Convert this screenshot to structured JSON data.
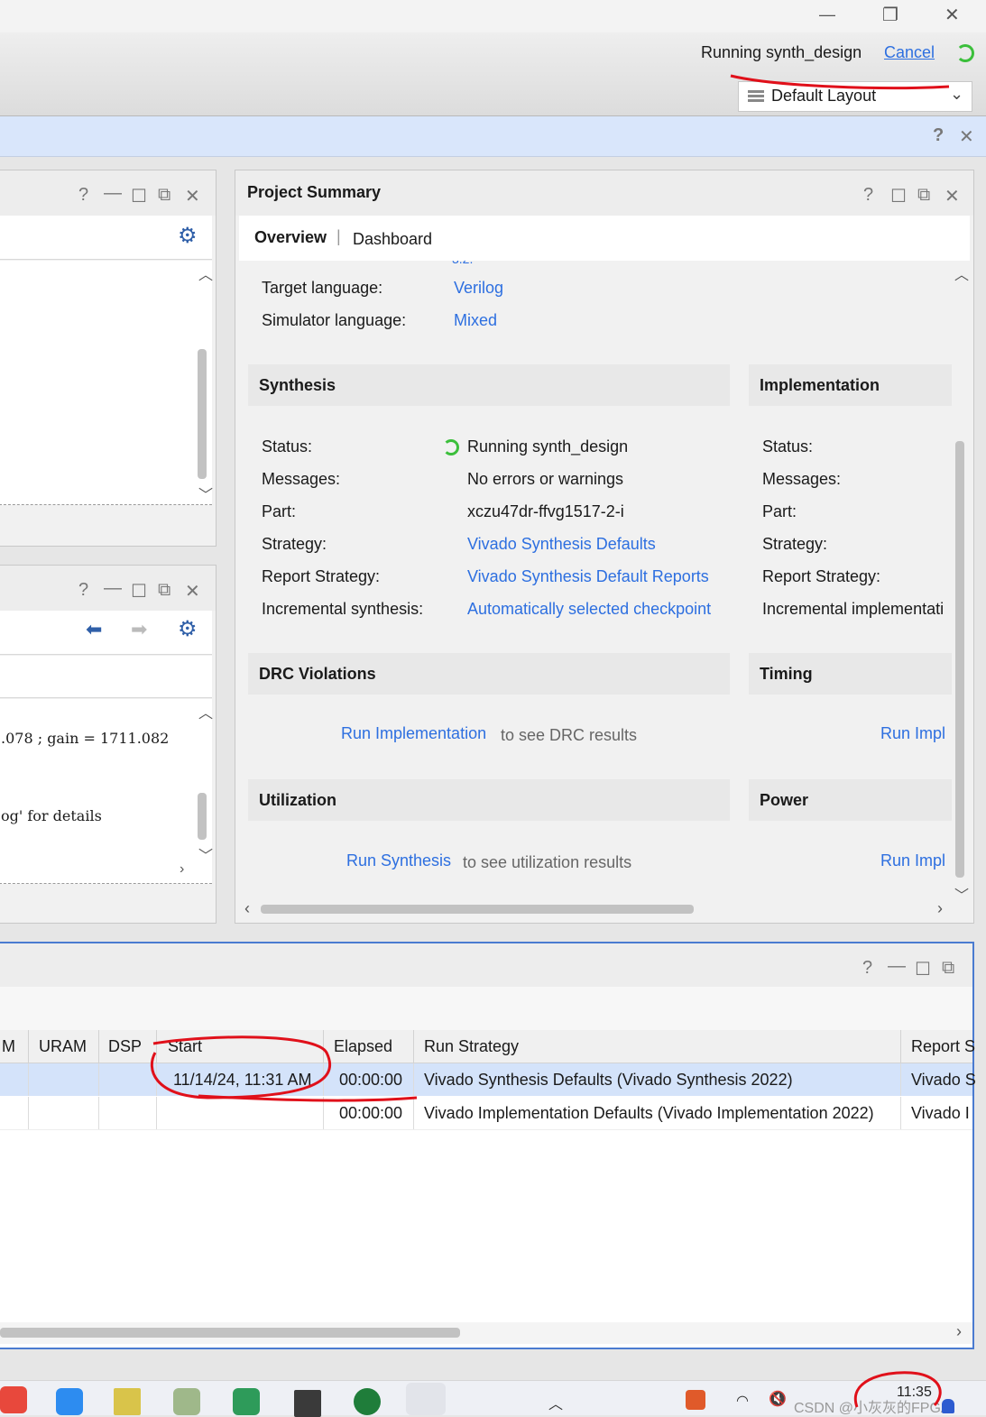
{
  "window": {
    "minimize": "—",
    "restore": "❐",
    "close": "✕"
  },
  "toolbar": {
    "status_text": "Running synth_design",
    "cancel_label": "Cancel",
    "layout_select": "Default Layout"
  },
  "bluebar": {
    "help": "?",
    "close": "✕"
  },
  "left_panels": {
    "top_controls": [
      "?",
      "—",
      "☐",
      "⧉",
      "✕"
    ],
    "mid_controls": [
      "?",
      "—",
      "☐",
      "⧉",
      "✕"
    ],
    "log_line_1": ".078 ; gain = 1711.082",
    "log_line_2": "og' for details"
  },
  "project_summary": {
    "title": "Project Summary",
    "controls": [
      "?",
      "☐",
      "⧉",
      "✕"
    ],
    "tabs": [
      "Overview",
      "Dashboard"
    ],
    "rows_top": [
      {
        "label": "Target language:",
        "value": "Verilog"
      },
      {
        "label": "Simulator language:",
        "value": "Mixed"
      }
    ],
    "synthesis": {
      "heading": "Synthesis",
      "rows": [
        {
          "label": "Status:",
          "value": "Running synth_design"
        },
        {
          "label": "Messages:",
          "value": "No errors or warnings"
        },
        {
          "label": "Part:",
          "value": "xczu47dr-ffvg1517-2-i"
        },
        {
          "label": "Strategy:",
          "value": "Vivado Synthesis Defaults"
        },
        {
          "label": "Report Strategy:",
          "value": "Vivado Synthesis Default Reports"
        },
        {
          "label": "Incremental synthesis:",
          "value": "Automatically selected checkpoint"
        }
      ]
    },
    "implementation": {
      "heading": "Implementation",
      "rows": [
        "Status:",
        "Messages:",
        "Part:",
        "Strategy:",
        "Report Strategy:",
        "Incremental implementati"
      ]
    },
    "drc": {
      "heading": "DRC Violations",
      "link": "Run Implementation",
      "suffix": "to see DRC results"
    },
    "timing": {
      "heading": "Timing",
      "link": "Run Impl"
    },
    "utilization": {
      "heading": "Utilization",
      "link": "Run Synthesis",
      "suffix": "to see utilization results"
    },
    "power": {
      "heading": "Power",
      "link": "Run Impl"
    }
  },
  "runs": {
    "controls": [
      "?",
      "—",
      "☐",
      "⧉"
    ],
    "columns": [
      "M",
      "URAM",
      "DSP",
      "Start",
      "Elapsed",
      "Run Strategy",
      "Report S"
    ],
    "rows": [
      {
        "start": "11/14/24, 11:31 AM",
        "elapsed": "00:00:00",
        "strategy": "Vivado Synthesis Defaults (Vivado Synthesis 2022)",
        "report": "Vivado S"
      },
      {
        "start": "",
        "elapsed": "00:00:00",
        "strategy": "Vivado Implementation Defaults (Vivado Implementation 2022)",
        "report": "Vivado I"
      }
    ]
  },
  "taskbar": {
    "watermark": "CSDN @小灰灰的FPGA",
    "clock": "11:35"
  }
}
